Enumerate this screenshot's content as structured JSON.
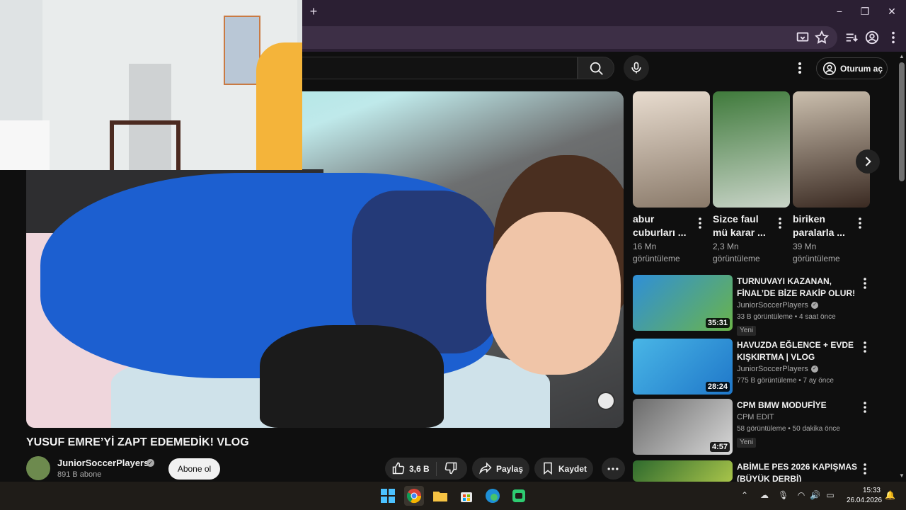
{
  "browser": {
    "new_tab_label": "+",
    "window_controls": {
      "minimize": "−",
      "maximize": "❐",
      "close": "✕"
    }
  },
  "header": {
    "sign_in_label": "Oturum aç"
  },
  "video": {
    "title": "YUSUF EMRE’Yİ ZAPT EDEMEDİK! VLOG",
    "channel_name": "JuniorSoccerPlayers",
    "subscribers": "891 B abone",
    "subscribe_label": "Abone ol",
    "likes": "3,6 B",
    "share_label": "Paylaş",
    "save_label": "Kaydet"
  },
  "shorts": [
    {
      "title_line1": "abur",
      "title_line2": "cuburları ...",
      "views_line1": "16 Mn",
      "views_line2": "görüntüleme",
      "colors": [
        "#e8dccf",
        "#8a7a6a"
      ]
    },
    {
      "title_line1": "Sizce faul",
      "title_line2": "mü karar ...",
      "views_line1": "2,3 Mn",
      "views_line2": "görüntüleme",
      "colors": [
        "#3f7a3b",
        "#c9d4c8"
      ]
    },
    {
      "title_line1": "biriken",
      "title_line2": "paralarla ...",
      "views_line1": "39 Mn",
      "views_line2": "görüntüleme",
      "colors": [
        "#cbbfae",
        "#3a2a22"
      ]
    }
  ],
  "recommendations": [
    {
      "title_line1": "TURNUVAYI KAZANAN,",
      "title_line2": "FİNAL’DE BİZE RAKİP OLUR! | ...",
      "channel": "JuniorSoccerPlayers",
      "verified": true,
      "meta": "33 B görüntüleme • 4 saat önce",
      "badge": "Yeni",
      "duration": "35:31",
      "colors": [
        "#2f8fd8",
        "#6ab44a"
      ]
    },
    {
      "title_line1": "HAVUZDA EĞLENCE + EVDE",
      "title_line2": "KIŞKIRTMA | VLOG",
      "channel": "JuniorSoccerPlayers",
      "verified": true,
      "meta": "775 B görüntüleme • 7 ay önce",
      "badge": "",
      "duration": "28:24",
      "colors": [
        "#49b6e6",
        "#1f77c9"
      ]
    },
    {
      "title_line1": "CPM BMW MODUFİYE",
      "title_line2": "",
      "channel": "CPM EDIT",
      "verified": false,
      "meta": "58 görüntüleme • 50 dakika önce",
      "badge": "Yeni",
      "duration": "4:57",
      "colors": [
        "#6a6a6a",
        "#d8d8d8"
      ]
    },
    {
      "title_line1": "ABİMLE PES 2026 KAPIŞMASI !!",
      "title_line2": "(BÜYÜK DERBİ)",
      "channel": "",
      "verified": false,
      "meta": "",
      "badge": "",
      "duration": "",
      "colors": [
        "#2e6a2e",
        "#a8c44a"
      ]
    }
  ],
  "taskbar": {
    "time": "15:33",
    "date": "26.04.2026"
  },
  "colors": {
    "browser_frame": "#2b1f33",
    "youtube_bg": "#0f0f0f",
    "pill_bg": "#272727"
  }
}
